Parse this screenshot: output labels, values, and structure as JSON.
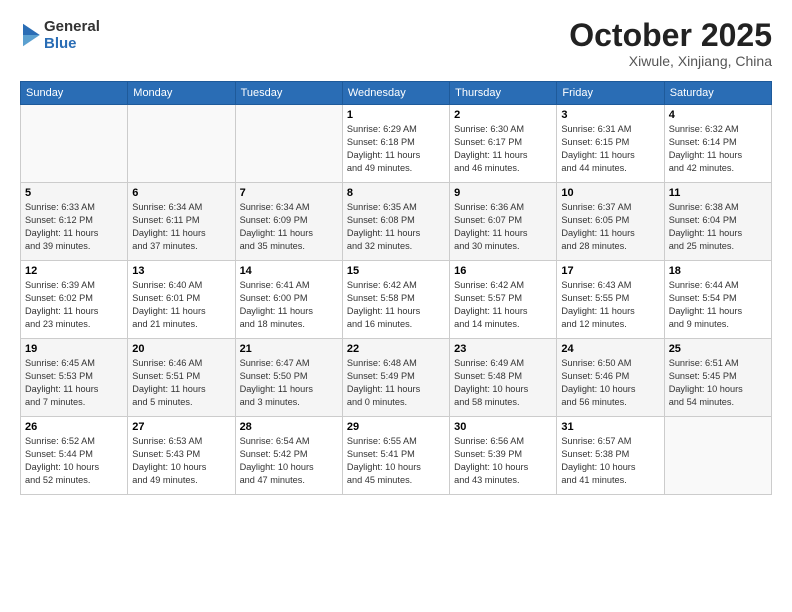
{
  "header": {
    "logo_line1": "General",
    "logo_line2": "Blue",
    "month": "October 2025",
    "location": "Xiwule, Xinjiang, China"
  },
  "days_of_week": [
    "Sunday",
    "Monday",
    "Tuesday",
    "Wednesday",
    "Thursday",
    "Friday",
    "Saturday"
  ],
  "weeks": [
    [
      {
        "day": "",
        "info": ""
      },
      {
        "day": "",
        "info": ""
      },
      {
        "day": "",
        "info": ""
      },
      {
        "day": "1",
        "info": "Sunrise: 6:29 AM\nSunset: 6:18 PM\nDaylight: 11 hours\nand 49 minutes."
      },
      {
        "day": "2",
        "info": "Sunrise: 6:30 AM\nSunset: 6:17 PM\nDaylight: 11 hours\nand 46 minutes."
      },
      {
        "day": "3",
        "info": "Sunrise: 6:31 AM\nSunset: 6:15 PM\nDaylight: 11 hours\nand 44 minutes."
      },
      {
        "day": "4",
        "info": "Sunrise: 6:32 AM\nSunset: 6:14 PM\nDaylight: 11 hours\nand 42 minutes."
      }
    ],
    [
      {
        "day": "5",
        "info": "Sunrise: 6:33 AM\nSunset: 6:12 PM\nDaylight: 11 hours\nand 39 minutes."
      },
      {
        "day": "6",
        "info": "Sunrise: 6:34 AM\nSunset: 6:11 PM\nDaylight: 11 hours\nand 37 minutes."
      },
      {
        "day": "7",
        "info": "Sunrise: 6:34 AM\nSunset: 6:09 PM\nDaylight: 11 hours\nand 35 minutes."
      },
      {
        "day": "8",
        "info": "Sunrise: 6:35 AM\nSunset: 6:08 PM\nDaylight: 11 hours\nand 32 minutes."
      },
      {
        "day": "9",
        "info": "Sunrise: 6:36 AM\nSunset: 6:07 PM\nDaylight: 11 hours\nand 30 minutes."
      },
      {
        "day": "10",
        "info": "Sunrise: 6:37 AM\nSunset: 6:05 PM\nDaylight: 11 hours\nand 28 minutes."
      },
      {
        "day": "11",
        "info": "Sunrise: 6:38 AM\nSunset: 6:04 PM\nDaylight: 11 hours\nand 25 minutes."
      }
    ],
    [
      {
        "day": "12",
        "info": "Sunrise: 6:39 AM\nSunset: 6:02 PM\nDaylight: 11 hours\nand 23 minutes."
      },
      {
        "day": "13",
        "info": "Sunrise: 6:40 AM\nSunset: 6:01 PM\nDaylight: 11 hours\nand 21 minutes."
      },
      {
        "day": "14",
        "info": "Sunrise: 6:41 AM\nSunset: 6:00 PM\nDaylight: 11 hours\nand 18 minutes."
      },
      {
        "day": "15",
        "info": "Sunrise: 6:42 AM\nSunset: 5:58 PM\nDaylight: 11 hours\nand 16 minutes."
      },
      {
        "day": "16",
        "info": "Sunrise: 6:42 AM\nSunset: 5:57 PM\nDaylight: 11 hours\nand 14 minutes."
      },
      {
        "day": "17",
        "info": "Sunrise: 6:43 AM\nSunset: 5:55 PM\nDaylight: 11 hours\nand 12 minutes."
      },
      {
        "day": "18",
        "info": "Sunrise: 6:44 AM\nSunset: 5:54 PM\nDaylight: 11 hours\nand 9 minutes."
      }
    ],
    [
      {
        "day": "19",
        "info": "Sunrise: 6:45 AM\nSunset: 5:53 PM\nDaylight: 11 hours\nand 7 minutes."
      },
      {
        "day": "20",
        "info": "Sunrise: 6:46 AM\nSunset: 5:51 PM\nDaylight: 11 hours\nand 5 minutes."
      },
      {
        "day": "21",
        "info": "Sunrise: 6:47 AM\nSunset: 5:50 PM\nDaylight: 11 hours\nand 3 minutes."
      },
      {
        "day": "22",
        "info": "Sunrise: 6:48 AM\nSunset: 5:49 PM\nDaylight: 11 hours\nand 0 minutes."
      },
      {
        "day": "23",
        "info": "Sunrise: 6:49 AM\nSunset: 5:48 PM\nDaylight: 10 hours\nand 58 minutes."
      },
      {
        "day": "24",
        "info": "Sunrise: 6:50 AM\nSunset: 5:46 PM\nDaylight: 10 hours\nand 56 minutes."
      },
      {
        "day": "25",
        "info": "Sunrise: 6:51 AM\nSunset: 5:45 PM\nDaylight: 10 hours\nand 54 minutes."
      }
    ],
    [
      {
        "day": "26",
        "info": "Sunrise: 6:52 AM\nSunset: 5:44 PM\nDaylight: 10 hours\nand 52 minutes."
      },
      {
        "day": "27",
        "info": "Sunrise: 6:53 AM\nSunset: 5:43 PM\nDaylight: 10 hours\nand 49 minutes."
      },
      {
        "day": "28",
        "info": "Sunrise: 6:54 AM\nSunset: 5:42 PM\nDaylight: 10 hours\nand 47 minutes."
      },
      {
        "day": "29",
        "info": "Sunrise: 6:55 AM\nSunset: 5:41 PM\nDaylight: 10 hours\nand 45 minutes."
      },
      {
        "day": "30",
        "info": "Sunrise: 6:56 AM\nSunset: 5:39 PM\nDaylight: 10 hours\nand 43 minutes."
      },
      {
        "day": "31",
        "info": "Sunrise: 6:57 AM\nSunset: 5:38 PM\nDaylight: 10 hours\nand 41 minutes."
      },
      {
        "day": "",
        "info": ""
      }
    ]
  ]
}
